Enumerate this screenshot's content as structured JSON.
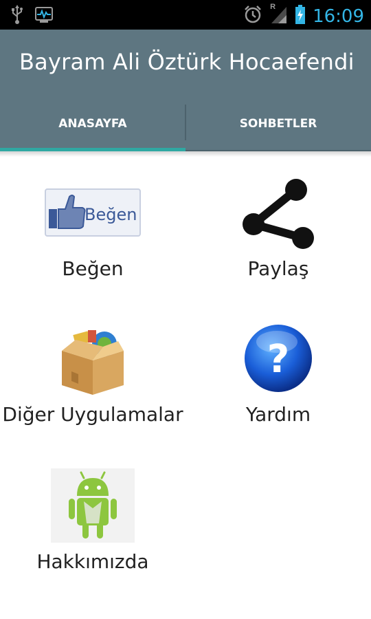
{
  "status_bar": {
    "time": "16:09",
    "icons": [
      "usb-icon",
      "activity-monitor-icon",
      "alarm-clock-icon",
      "signal-icon",
      "battery-charging-icon"
    ],
    "signal_badge": "R"
  },
  "app": {
    "title": "Bayram Ali Öztürk Hocaefendi"
  },
  "tabs": [
    {
      "label": "ANASAYFA",
      "selected": true
    },
    {
      "label": "SOHBETLER",
      "selected": false
    }
  ],
  "grid": {
    "items": [
      {
        "label": "Beğen",
        "icon": "facebook-like-icon",
        "icon_text": "Beğen"
      },
      {
        "label": "Paylaş",
        "icon": "share-icon"
      },
      {
        "label": "Diğer Uygulamalar",
        "icon": "app-box-icon"
      },
      {
        "label": "Yardım",
        "icon": "help-icon",
        "icon_text": "?"
      },
      {
        "label": "Hakkımızda",
        "icon": "android-icon"
      }
    ]
  },
  "colors": {
    "status_bar": "#000000",
    "action_bar": "#5e7681",
    "tab_indicator": "#2fa8a2",
    "time_text": "#33b5e5"
  }
}
